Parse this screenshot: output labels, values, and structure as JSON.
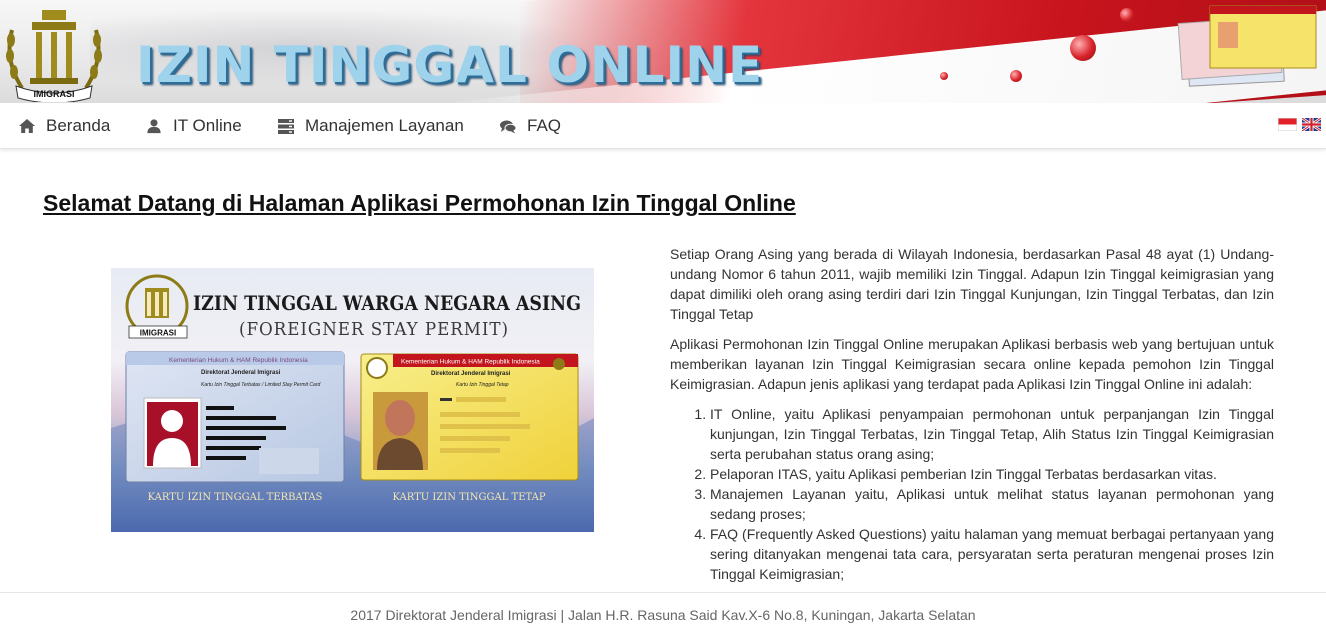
{
  "header": {
    "banner_title": "IZIN TINGGAL ONLINE",
    "emblem_text": "IMIGRASI"
  },
  "nav": {
    "items": [
      {
        "label": "Beranda",
        "icon": "home-icon"
      },
      {
        "label": "IT Online",
        "icon": "user-icon"
      },
      {
        "label": "Manajemen Layanan",
        "icon": "server-icon"
      },
      {
        "label": "FAQ",
        "icon": "comments-icon"
      }
    ],
    "languages": [
      "id",
      "en"
    ]
  },
  "main": {
    "title": "Selamat Datang di Halaman Aplikasi Permohonan Izin Tinggal Online",
    "hero": {
      "heading": "IZIN TINGGAL WARGA NEGARA ASING",
      "subheading": "(FOREIGNER STAY PERMIT)",
      "emblem_text": "IMIGRASI",
      "card_left": {
        "ministry": "Kementerian Hukum & HAM Republik Indonesia",
        "directorate": "Direktorat Jenderal Imigrasi",
        "card_title": "Kartu Izin Tinggal Terbatas / Limited Stay Permit Card",
        "caption": "KARTU IZIN TINGGAL TERBATAS"
      },
      "card_right": {
        "ministry": "Kementerian Hukum & HAM Republik Indonesia",
        "directorate": "Direktorat Jenderal Imigrasi",
        "card_title": "Kartu Izin Tinggal Tetap",
        "caption": "KARTU IZIN TINGGAL TETAP"
      }
    },
    "paragraph1": "Setiap Orang Asing yang berada di Wilayah Indonesia, berdasarkan Pasal 48 ayat (1) Undang-undang Nomor 6 tahun 2011, wajib memiliki Izin Tinggal. Adapun Izin Tinggal keimigrasian yang dapat dimiliki oleh orang asing terdiri dari Izin Tinggal Kunjungan, Izin Tinggal Terbatas, dan Izin Tinggal Tetap",
    "paragraph2": "Aplikasi Permohonan Izin Tinggal Online merupakan Aplikasi berbasis web yang bertujuan untuk memberikan layanan Izin Tinggal Keimigrasian secara online kepada pemohon Izin Tinggal Keimigrasian. Adapun jenis aplikasi yang terdapat pada Aplikasi Izin Tinggal Online ini adalah:",
    "list": [
      "IT Online, yaitu Aplikasi penyampaian permohonan untuk perpanjangan Izin Tinggal kunjungan, Izin Tinggal Terbatas, Izin Tinggal Tetap, Alih Status Izin Tinggal Keimigrasian serta perubahan status orang asing;",
      "Pelaporan ITAS, yaitu Aplikasi pemberian Izin Tinggal Terbatas berdasarkan vitas.",
      "Manajemen Layanan yaitu, Aplikasi untuk melihat status layanan permohonan yang sedang proses;",
      "FAQ (Frequently Asked Questions) yaitu halaman yang memuat berbagai pertanyaan yang sering ditanyakan mengenai tata cara, persyaratan serta peraturan mengenai proses Izin Tinggal Keimigrasian;"
    ]
  },
  "footer": {
    "text": "2017 Direktorat Jenderal Imigrasi | Jalan H.R. Rasuna Said Kav.X-6 No.8, Kuningan, Jakarta Selatan"
  },
  "colors": {
    "banner_red": "#c8141d",
    "banner_title": "#9fd3ec",
    "link_text": "#333333"
  }
}
